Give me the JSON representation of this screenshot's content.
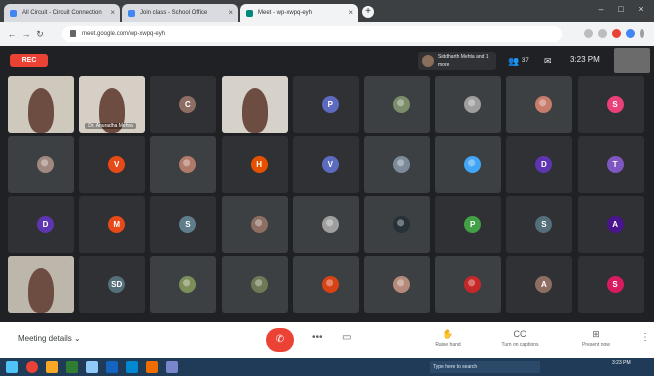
{
  "browser": {
    "tabs": [
      {
        "label": "All Circuit - Circuit Connection",
        "active": false
      },
      {
        "label": "Join class - School Office",
        "active": false
      },
      {
        "label": "Meet - wp-xwpq-eyh",
        "active": true
      }
    ],
    "url": "meet.google.com/wp-xwpq-eyh"
  },
  "meet": {
    "rec_label": "REC",
    "presenter_label": "Siddharth Mehta and 1 more",
    "participant_count": "37",
    "clock": "3:23 PM",
    "bottom": {
      "details_label": "Meeting details",
      "details_chevron": "⌄",
      "items": [
        {
          "icon": "raise-hand-icon",
          "glyph": "✋",
          "label": "Raise hand"
        },
        {
          "icon": "captions-icon",
          "glyph": "CC",
          "label": "Turn on captions"
        },
        {
          "icon": "present-icon",
          "glyph": "⊞",
          "label": "Present now"
        }
      ]
    },
    "tiles": [
      {
        "kind": "video",
        "name": "",
        "color": "#cfc8bd"
      },
      {
        "kind": "video",
        "name": "Dr. Anuradha Mehra",
        "color": "#d6cfc6"
      },
      {
        "kind": "avatar",
        "letter": "C",
        "color": "#8d6e63"
      },
      {
        "kind": "video",
        "name": "",
        "color": "#d7d2c9"
      },
      {
        "kind": "avatar",
        "letter": "P",
        "color": "#5c6bc0"
      },
      {
        "kind": "photo",
        "color": "#7b8d6a"
      },
      {
        "kind": "photo",
        "color": "#9e9e9e"
      },
      {
        "kind": "photo",
        "color": "#c77b6b"
      },
      {
        "kind": "avatar",
        "letter": "S",
        "color": "#ec407a"
      },
      {
        "kind": "photo",
        "color": "#a1887f"
      },
      {
        "kind": "avatar",
        "letter": "V",
        "color": "#e64a19"
      },
      {
        "kind": "photo",
        "color": "#b07a6a"
      },
      {
        "kind": "avatar",
        "letter": "H",
        "color": "#e65100"
      },
      {
        "kind": "avatar",
        "letter": "V",
        "color": "#5c6bc0"
      },
      {
        "kind": "photo",
        "color": "#7d8a9a"
      },
      {
        "kind": "photo",
        "color": "#42a5f5"
      },
      {
        "kind": "avatar",
        "letter": "D",
        "color": "#5e35b1"
      },
      {
        "kind": "avatar",
        "letter": "T",
        "color": "#7e57c2"
      },
      {
        "kind": "avatar",
        "letter": "D",
        "color": "#5e35b1"
      },
      {
        "kind": "avatar",
        "letter": "M",
        "color": "#e64a19"
      },
      {
        "kind": "avatar",
        "letter": "S",
        "color": "#607d8b"
      },
      {
        "kind": "photo",
        "color": "#8d6e63"
      },
      {
        "kind": "photo",
        "color": "#9e9e9e"
      },
      {
        "kind": "photo",
        "color": "#263238"
      },
      {
        "kind": "avatar",
        "letter": "P",
        "color": "#43a047"
      },
      {
        "kind": "avatar",
        "letter": "S",
        "color": "#546e7a"
      },
      {
        "kind": "avatar",
        "letter": "A",
        "color": "#4a148c"
      },
      {
        "kind": "video",
        "name": "",
        "color": "#bdb6ab"
      },
      {
        "kind": "avatar",
        "letter": "SD",
        "color": "#546e7a"
      },
      {
        "kind": "photo",
        "color": "#7c8f5a"
      },
      {
        "kind": "photo",
        "color": "#6d7a55"
      },
      {
        "kind": "photo",
        "color": "#d84315"
      },
      {
        "kind": "photo",
        "color": "#b58a7a"
      },
      {
        "kind": "photo",
        "color": "#c62828"
      },
      {
        "kind": "avatar",
        "letter": "A",
        "color": "#8d6e63"
      },
      {
        "kind": "avatar",
        "letter": "S",
        "color": "#d81b60"
      }
    ]
  },
  "taskbar": {
    "search_text": "Type here to search",
    "time": "3:23 PM"
  }
}
